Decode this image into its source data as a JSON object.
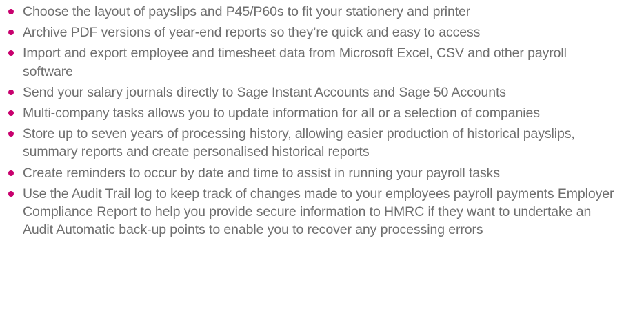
{
  "accent_color": "#c8006e",
  "text_color": "#6f6f6f",
  "features": [
    {
      "text": "Choose the layout of payslips and P45/P60s to fit your stationery and printer"
    },
    {
      "text": "Archive PDF versions of year-end reports so they’re quick and easy to access"
    },
    {
      "text": "Import and export employee and timesheet data from Microsoft Excel, CSV and other payroll software"
    },
    {
      "text": "Send your salary journals directly to Sage Instant Accounts and Sage 50 Accounts"
    },
    {
      "text": "Multi-company tasks allows you to update information for all or a selection of companies"
    },
    {
      "text": "Store up to seven years of processing history, allowing easier production of historical payslips, summary reports and create personalised historical reports"
    },
    {
      "text": "Create reminders to occur by date and time to assist in running your payroll tasks"
    },
    {
      "text": "Use the Audit Trail log to keep track of changes made to your employees payroll payments Employer Compliance Report to help you provide secure information to HMRC if they want to undertake an Audit Automatic back-up points to enable you to recover any processing errors"
    }
  ]
}
